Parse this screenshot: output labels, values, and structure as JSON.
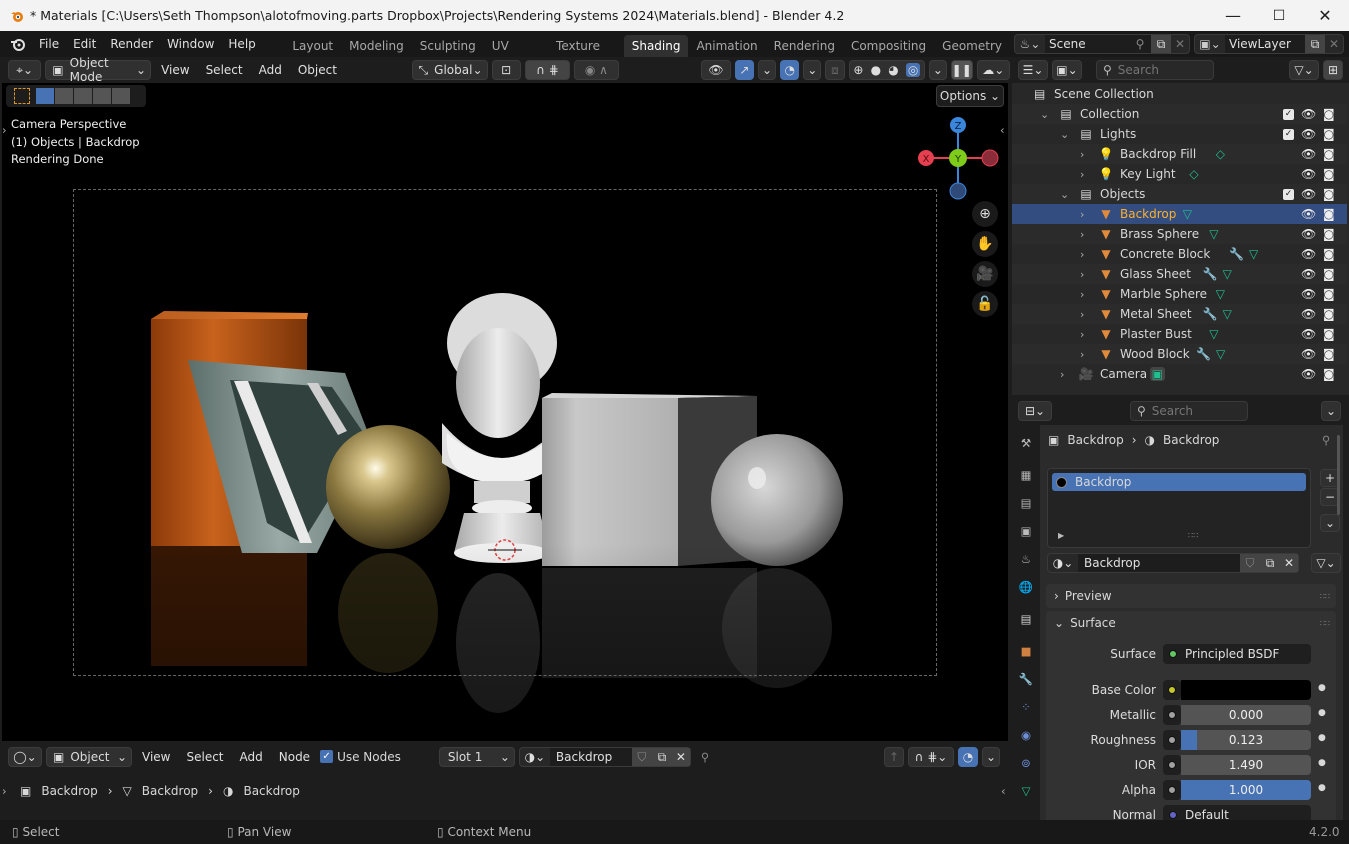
{
  "window": {
    "title": "* Materials [C:\\Users\\Seth Thompson\\alotofmoving.parts Dropbox\\Projects\\Rendering Systems 2024\\Materials.blend] - Blender 4.2",
    "controls": {
      "minimize": "—",
      "maximize": "☐",
      "close": "✕"
    }
  },
  "menu": [
    "File",
    "Edit",
    "Render",
    "Window",
    "Help"
  ],
  "workspaces": {
    "tabs": [
      "Layout",
      "Modeling",
      "Sculpting",
      "UV Editing",
      "Texture Paint",
      "Shading",
      "Animation",
      "Rendering",
      "Compositing",
      "Geometry N"
    ],
    "active": "Shading"
  },
  "scene_selector": {
    "scene": "Scene",
    "view_layer": "ViewLayer"
  },
  "viewport": {
    "mode": "Object Mode",
    "menus": [
      "View",
      "Select",
      "Add",
      "Object"
    ],
    "transform_orientation": "Global",
    "options_label": "Options",
    "overlay": {
      "line1": "Camera Perspective",
      "line2": "(1) Objects | Backdrop",
      "line3": "Rendering Done"
    },
    "gizmo": {
      "x": "X",
      "y": "Y",
      "z": "Z"
    },
    "navigation": [
      "zoom",
      "pan",
      "camera",
      "lock"
    ],
    "shading_mode": "rendered"
  },
  "outliner": {
    "search_placeholder": "Search",
    "root": "Scene Collection",
    "items": [
      {
        "name": "Collection",
        "type": "collection",
        "depth": 1,
        "expanded": true,
        "checkbox": true
      },
      {
        "name": "Lights",
        "type": "collection",
        "depth": 2,
        "expanded": true,
        "checkbox": true
      },
      {
        "name": "Backdrop Fill",
        "type": "light",
        "depth": 3,
        "modifier": false
      },
      {
        "name": "Key Light",
        "type": "light",
        "depth": 3,
        "modifier": false
      },
      {
        "name": "Objects",
        "type": "collection",
        "depth": 2,
        "expanded": true,
        "checkbox": true
      },
      {
        "name": "Backdrop",
        "type": "mesh",
        "depth": 3,
        "selected": true,
        "modifier": false
      },
      {
        "name": "Brass Sphere",
        "type": "mesh",
        "depth": 3,
        "modifier": false
      },
      {
        "name": "Concrete  Block",
        "type": "mesh",
        "depth": 3,
        "modifier": true
      },
      {
        "name": "Glass Sheet",
        "type": "mesh",
        "depth": 3,
        "modifier": true
      },
      {
        "name": "Marble Sphere",
        "type": "mesh",
        "depth": 3,
        "modifier": false
      },
      {
        "name": "Metal Sheet",
        "type": "mesh",
        "depth": 3,
        "modifier": true
      },
      {
        "name": "Plaster Bust",
        "type": "mesh",
        "depth": 3,
        "modifier": false
      },
      {
        "name": "Wood Block",
        "type": "mesh",
        "depth": 3,
        "modifier": true
      },
      {
        "name": "Camera",
        "type": "camera",
        "depth": 2
      }
    ]
  },
  "properties": {
    "search_placeholder": "Search",
    "breadcrumb": [
      "Backdrop",
      "Backdrop"
    ],
    "material_slots": [
      "Backdrop"
    ],
    "material_name": "Backdrop",
    "panels": {
      "preview": "Preview",
      "surface": "Surface"
    },
    "fields": {
      "surface": {
        "label": "Surface",
        "value": "Principled BSDF"
      },
      "base_color": {
        "label": "Base Color",
        "value": "#000000"
      },
      "metallic": {
        "label": "Metallic",
        "value": "0.000",
        "fraction": 0.0
      },
      "roughness": {
        "label": "Roughness",
        "value": "0.123",
        "fraction": 0.123
      },
      "ior": {
        "label": "IOR",
        "value": "1.490",
        "fraction": 0.0
      },
      "alpha": {
        "label": "Alpha",
        "value": "1.000",
        "fraction": 1.0
      },
      "normal": {
        "label": "Normal",
        "value": "Default"
      }
    }
  },
  "node_editor": {
    "type": "Object",
    "menus": [
      "View",
      "Select",
      "Add",
      "Node"
    ],
    "use_nodes_label": "Use Nodes",
    "use_nodes": true,
    "slot": "Slot 1",
    "material": "Backdrop",
    "breadcrumb": [
      "Backdrop",
      "Backdrop",
      "Backdrop"
    ]
  },
  "statusbar": {
    "hints": [
      "Select",
      "Pan View",
      "Context Menu"
    ],
    "version": "4.2.0"
  },
  "colors": {
    "accent": "#4772b3",
    "selected_text": "#ffaf29",
    "axis_x": "#e5404f",
    "axis_y": "#7fcb19",
    "axis_z": "#3a86db",
    "object_orange": "#e08a3c",
    "mesh_data_green": "#1fbf8f",
    "modifier_blue": "#6d8fd8"
  }
}
